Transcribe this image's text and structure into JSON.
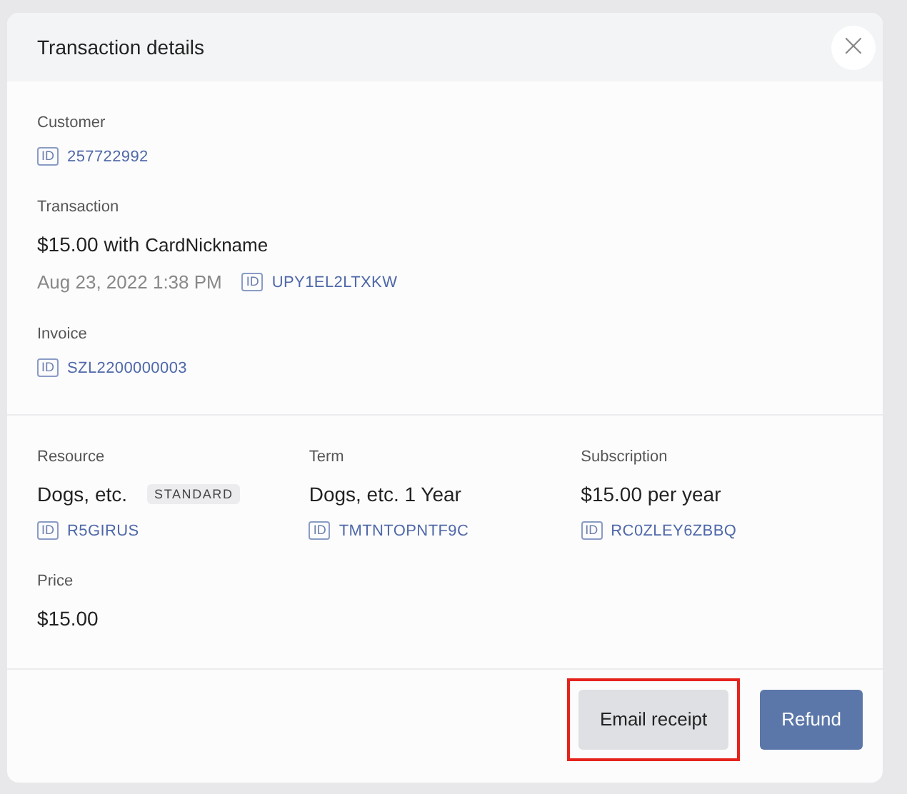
{
  "dialog": {
    "title": "Transaction details",
    "close_icon": "×"
  },
  "sections": [
    {
      "fields": [
        {
          "label": "Customer",
          "lines": [
            {
              "kind": "id",
              "tag": "ID",
              "value": "257722992"
            }
          ]
        },
        {
          "label": "Transaction",
          "lines": [
            {
              "kind": "amount",
              "value": "$15.00 with",
              "note": "CardNickname"
            },
            {
              "kind": "meta",
              "value": "Aug 23, 2022 1:38 PM",
              "tag": "ID",
              "id": "UPY1EL2LTXKW"
            }
          ]
        },
        {
          "label": "Invoice",
          "lines": [
            {
              "kind": "id",
              "tag": "ID",
              "value": "SZL2200000003"
            }
          ]
        }
      ]
    },
    {
      "kind": "grid",
      "fields": [
        {
          "label": "Resource",
          "lines": [
            {
              "kind": "amount",
              "value": "Dogs, etc.",
              "badge": "STANDARD"
            },
            {
              "kind": "id",
              "tag": "ID",
              "value": "R5GIRUS"
            }
          ]
        },
        {
          "label": "Term",
          "lines": [
            {
              "kind": "amount",
              "value": "Dogs, etc. 1 Year"
            },
            {
              "kind": "id",
              "tag": "ID",
              "value": "TMTNTOPNTF9C"
            }
          ]
        },
        {
          "label": "Subscription",
          "lines": [
            {
              "kind": "amount",
              "value": "$15.00 per year"
            },
            {
              "kind": "id",
              "tag": "ID",
              "value": "RC0ZLEY6ZBBQ"
            }
          ]
        },
        {
          "label": "Price",
          "lines": [
            {
              "kind": "amount",
              "value": "$15.00"
            }
          ]
        }
      ]
    }
  ],
  "buttons": [
    {
      "label": "Email receipt",
      "kind": "secondary",
      "highlighted": true
    },
    {
      "label": "Refund",
      "kind": "primary",
      "highlighted": false
    }
  ]
}
